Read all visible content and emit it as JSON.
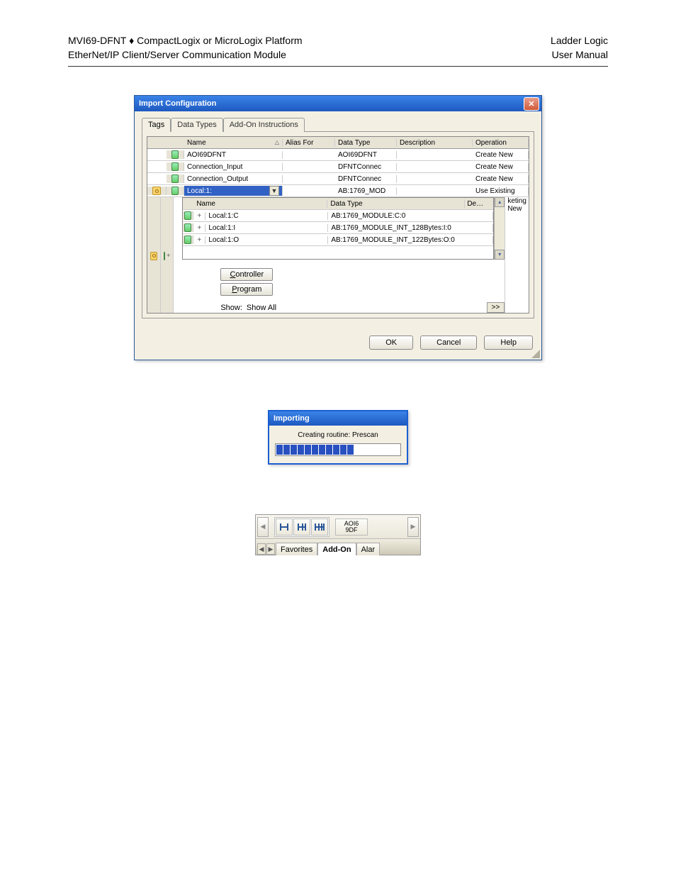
{
  "page_header": {
    "left1": "MVI69-DFNT ♦ CompactLogix or MicroLogix Platform",
    "left2": "EtherNet/IP Client/Server Communication Module",
    "right1": "Ladder Logic",
    "right2": "User Manual"
  },
  "import_dialog": {
    "title": "Import Configuration",
    "tabs": {
      "t1": "Tags",
      "t2": "Data Types",
      "t3": "Add-On Instructions"
    },
    "headers": {
      "name": "Name",
      "alias": "Alias For",
      "type": "Data Type",
      "desc": "Description",
      "op": "Operation"
    },
    "rows": [
      {
        "name": "AOI69DFNT",
        "type": "AOI69DFNT",
        "op": "Create New"
      },
      {
        "name": "Connection_Input",
        "type": "DFNTConnec",
        "op": "Create New"
      },
      {
        "name": "Connection_Output",
        "type": "DFNTConnec",
        "op": "Create New"
      },
      {
        "name": "Local:1:",
        "type": "AB:1769_MOD",
        "op": "Use Existing"
      }
    ],
    "op_trunc": {
      "a": "keting",
      "b": "New"
    },
    "sub_headers": {
      "name": "Name",
      "type": "Data Type",
      "de": "De…"
    },
    "sub_rows": [
      {
        "name": "Local:1:C",
        "type": "AB:1769_MODULE:C:0"
      },
      {
        "name": "Local:1:I",
        "type": "AB:1769_MODULE_INT_128Bytes:I:0"
      },
      {
        "name": "Local:1:O",
        "type": "AB:1769_MODULE_INT_122Bytes:O:0"
      }
    ],
    "buttons": {
      "controller": "Controller",
      "program": "Program"
    },
    "show_label": "Show:",
    "show_value": "Show All",
    "expand": ">>",
    "ok": "OK",
    "cancel": "Cancel",
    "help": "Help"
  },
  "progress_dialog": {
    "title": "Importing",
    "message": "Creating routine: Prescan"
  },
  "ribbon": {
    "block_label": "AOI6\n9DF",
    "tabs": {
      "fav": "Favorites",
      "addon": "Add-On",
      "alar": "Alar"
    }
  }
}
